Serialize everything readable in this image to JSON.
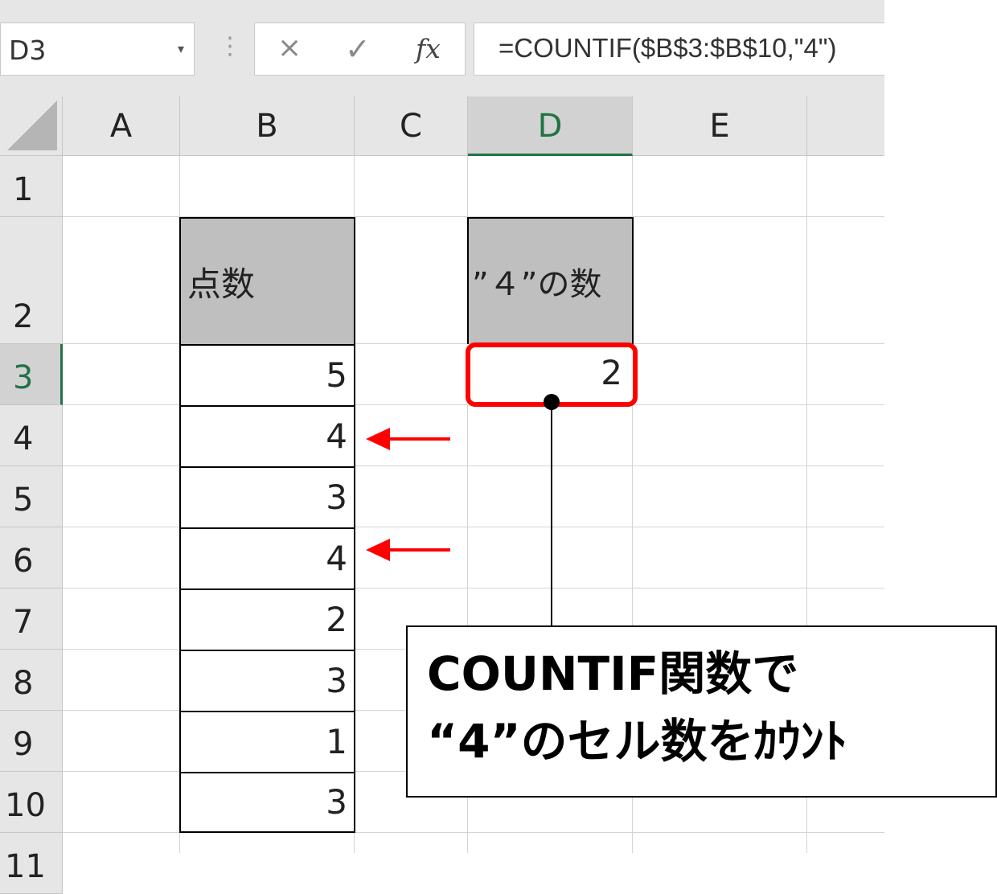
{
  "formula_bar": {
    "name_box": "D3",
    "cancel_icon": "×",
    "enter_icon": "✓",
    "fx_label": "fx",
    "formula": "=COUNTIF($B$3:$B$10,\"4\")"
  },
  "columns": [
    "A",
    "B",
    "C",
    "D",
    "E"
  ],
  "rows": [
    "1",
    "2",
    "3",
    "4",
    "5",
    "6",
    "7",
    "8",
    "9",
    "10",
    "11"
  ],
  "table": {
    "header": "点数",
    "values": [
      "5",
      "4",
      "3",
      "4",
      "2",
      "3",
      "1",
      "3"
    ]
  },
  "result": {
    "header": "”４”の数",
    "value": "2"
  },
  "callout": {
    "line1": "COUNTIF関数で",
    "line2": "“4”のセル数をｶｳﾝﾄ"
  },
  "colors": {
    "accent": "#217346",
    "highlight": "#ff0000",
    "header_fill": "#bfbfbf"
  }
}
